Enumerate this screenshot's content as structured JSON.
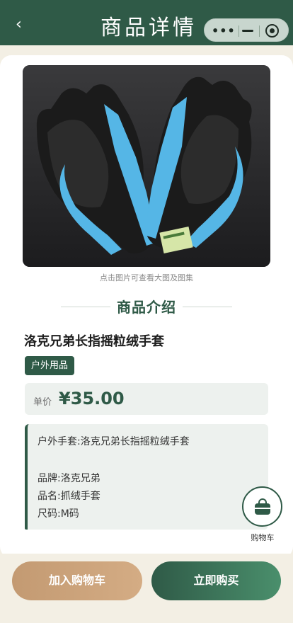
{
  "header": {
    "back_icon": "chevron-left-icon",
    "title": "商品详情",
    "capsule": {
      "more_icon": "more-dots-icon",
      "minimize_icon": "minimize-icon",
      "close_icon": "target-circle-icon"
    }
  },
  "product": {
    "image_hint": "点击图片可查看大图及图集",
    "section_title": "商品介绍",
    "name": "洛克兄弟长指摇粒绒手套",
    "category": "户外用品",
    "price_label": "单价",
    "price": "¥35.00",
    "description": [
      "户外手套:洛克兄弟长指摇粒绒手套",
      "",
      "品牌:洛克兄弟",
      "品名:抓绒手套",
      "尺码:M码"
    ]
  },
  "floating_cart": {
    "icon": "shopping-bag-icon",
    "label": "购物车"
  },
  "actions": {
    "add_to_cart": "加入购物车",
    "buy_now": "立即购买"
  },
  "colors": {
    "primary": "#2f5a47",
    "accent": "#c39a72",
    "background": "#f3efe4"
  }
}
